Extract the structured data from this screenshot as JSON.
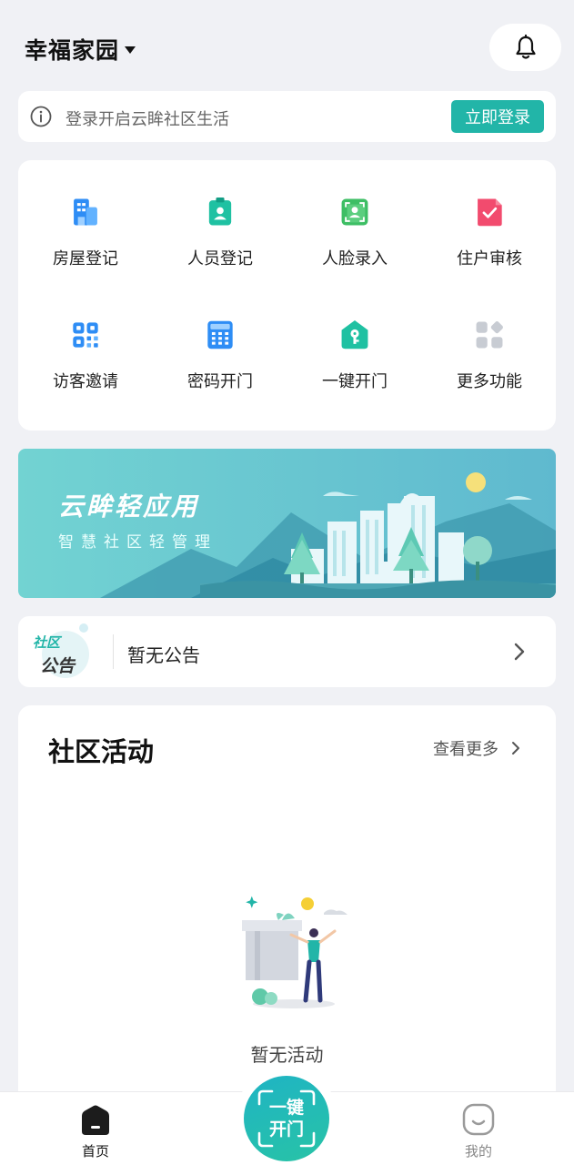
{
  "header": {
    "community_name": "幸福家园"
  },
  "login_bar": {
    "text": "登录开启云眸社区生活",
    "button_label": "立即登录"
  },
  "functions": [
    {
      "label": "房屋登记",
      "icon": "building-icon"
    },
    {
      "label": "人员登记",
      "icon": "person-badge-icon"
    },
    {
      "label": "人脸录入",
      "icon": "face-scan-icon"
    },
    {
      "label": "住户审核",
      "icon": "checkmark-document-icon"
    },
    {
      "label": "访客邀请",
      "icon": "qr-code-icon"
    },
    {
      "label": "密码开门",
      "icon": "keypad-icon"
    },
    {
      "label": "一键开门",
      "icon": "key-house-icon"
    },
    {
      "label": "更多功能",
      "icon": "grid-more-icon"
    }
  ],
  "banner": {
    "title": "云眸轻应用",
    "subtitle": "智慧社区轻管理"
  },
  "notice": {
    "badge_line1": "社区",
    "badge_line2": "公告",
    "text": "暂无公告"
  },
  "activity": {
    "title": "社区活动",
    "more_label": "查看更多",
    "empty_text": "暂无活动"
  },
  "tabbar": {
    "home_label": "首页",
    "center_line1": "一键",
    "center_line2": "开门",
    "mine_label": "我的"
  },
  "colors": {
    "accent": "#22b5a8",
    "background": "#f0f1f5",
    "banner": "#6ccfcf"
  }
}
